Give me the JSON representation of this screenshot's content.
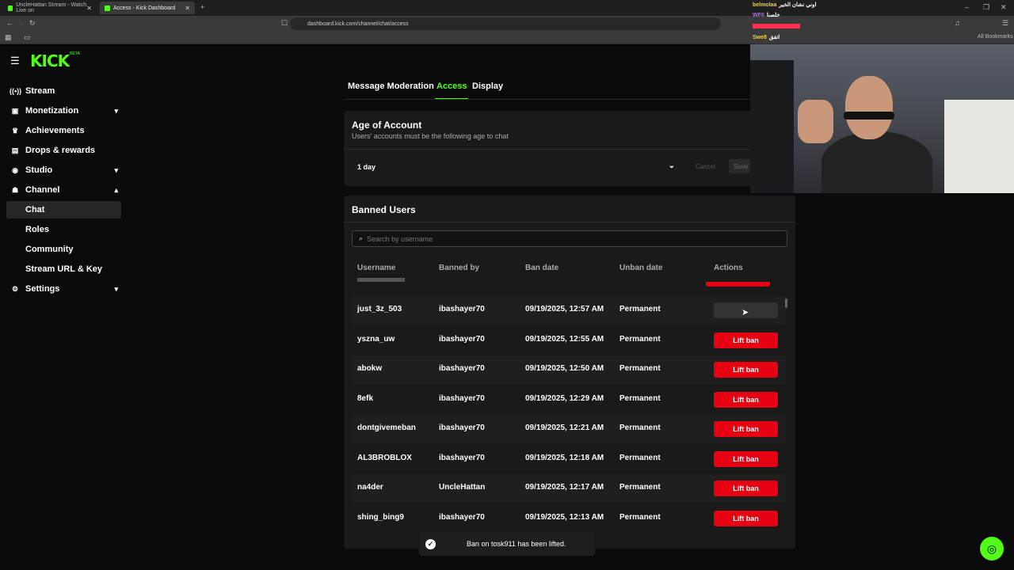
{
  "browser": {
    "tabs": [
      {
        "label": "UncleHattan Stream - Watch Live on",
        "active": false
      },
      {
        "label": "Access - Kick Dashboard",
        "active": true
      }
    ],
    "url": "dashboard.kick.com/channel/chat/access",
    "bookmarks_label": "All Bookmarks"
  },
  "brand": {
    "logo": "KICK",
    "badge": "BETA"
  },
  "sidebar": {
    "items": [
      {
        "label": "Stream",
        "icon": "broadcast-icon"
      },
      {
        "label": "Monetization",
        "icon": "wallet-icon",
        "chevron": "down"
      },
      {
        "label": "Achievements",
        "icon": "trophy-icon"
      },
      {
        "label": "Drops & rewards",
        "icon": "gift-icon"
      },
      {
        "label": "Studio",
        "icon": "studio-icon",
        "chevron": "down"
      },
      {
        "label": "Channel",
        "icon": "channel-icon",
        "chevron": "up"
      }
    ],
    "channel_sub": [
      "Chat",
      "Roles",
      "Community",
      "Stream URL & Key"
    ],
    "settings": {
      "label": "Settings",
      "icon": "gear-icon",
      "chevron": "down"
    }
  },
  "tabs": {
    "moderation": "Message Moderation",
    "access": "Access",
    "display": "Display"
  },
  "age": {
    "title": "Age of Account",
    "subtitle": "Users' accounts must be the following age to chat",
    "value": "1 day",
    "cancel": "Cancel",
    "save": "Save"
  },
  "banned": {
    "title": "Banned Users",
    "search_placeholder": "Search by username",
    "columns": {
      "username": "Username",
      "banned_by": "Banned by",
      "ban_date": "Ban date",
      "unban_date": "Unban date",
      "actions": "Actions"
    },
    "lift_label": "Lift ban",
    "rows": [
      {
        "username": "just_3z_503",
        "banned_by": "ibashayer70",
        "ban_date": "09/19/2025, 12:57 AM",
        "unban_date": "Permanent"
      },
      {
        "username": "yszna_uw",
        "banned_by": "ibashayer70",
        "ban_date": "09/19/2025, 12:55 AM",
        "unban_date": "Permanent"
      },
      {
        "username": "abokw",
        "banned_by": "ibashayer70",
        "ban_date": "09/19/2025, 12:50 AM",
        "unban_date": "Permanent"
      },
      {
        "username": "8efk",
        "banned_by": "ibashayer70",
        "ban_date": "09/19/2025, 12:29 AM",
        "unban_date": "Permanent"
      },
      {
        "username": "dontgivemeban",
        "banned_by": "ibashayer70",
        "ban_date": "09/19/2025, 12:21 AM",
        "unban_date": "Permanent"
      },
      {
        "username": "AL3BROBLOX",
        "banned_by": "ibashayer70",
        "ban_date": "09/19/2025, 12:18 AM",
        "unban_date": "Permanent"
      },
      {
        "username": "na4der",
        "banned_by": "UncleHattan",
        "ban_date": "09/19/2025, 12:17 AM",
        "unban_date": "Permanent"
      },
      {
        "username": "shing_bing9",
        "banned_by": "ibashayer70",
        "ban_date": "09/19/2025, 12:13 AM",
        "unban_date": "Permanent"
      }
    ]
  },
  "toast": {
    "text": "Ban on tosk911 has been lifted."
  },
  "overlay_chat": [
    {
      "user": "belmolaa",
      "msg": "اوني نشان الخير",
      "color": "#f5d020"
    },
    {
      "user": "WF0",
      "msg": "خلصنا",
      "color": "#b06cff"
    },
    {
      "user": "",
      "msg": "",
      "color": "#ff3050"
    },
    {
      "user": "Swe8",
      "msg": "اتفق",
      "color": "#f5d020"
    }
  ],
  "colors": {
    "accent": "#53fc18",
    "danger": "#e60012"
  }
}
